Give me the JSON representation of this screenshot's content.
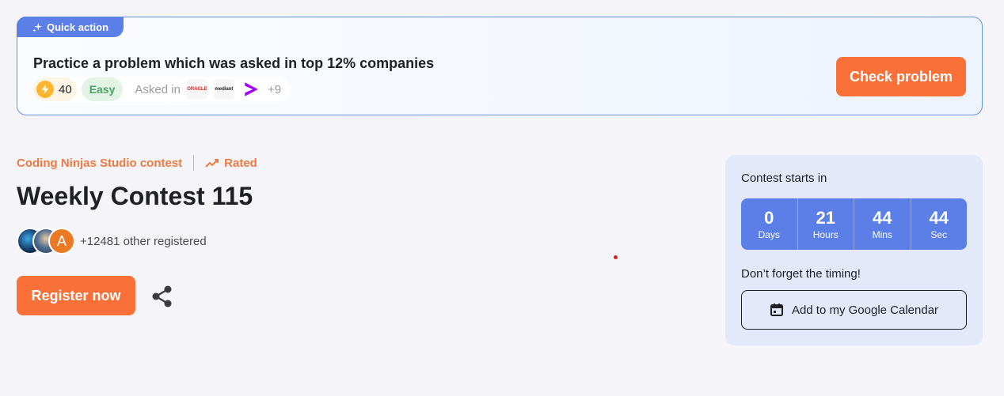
{
  "quick_action": {
    "tag": "Quick action",
    "title": "Practice a problem which was asked in top 12% companies",
    "points": "40",
    "difficulty": "Easy",
    "asked_in_label": "Asked in",
    "companies": [
      {
        "name": "ORACLE",
        "icon": "oracle-logo"
      },
      {
        "name": "mediant",
        "icon": "medianet-logo"
      },
      {
        "name": ">",
        "icon": "accenture-logo"
      }
    ],
    "more_companies": "+9",
    "cta": "Check problem"
  },
  "contest": {
    "category": "Coding Ninjas Studio contest",
    "rated_label": "Rated",
    "title": "Weekly Contest 115",
    "avatar_letter": "A",
    "registered_text": "+12481 other registered",
    "register_cta": "Register now"
  },
  "countdown": {
    "heading": "Contest starts in",
    "cells": [
      {
        "value": "0",
        "unit": "Days"
      },
      {
        "value": "21",
        "unit": "Hours"
      },
      {
        "value": "44",
        "unit": "Mins"
      },
      {
        "value": "44",
        "unit": "Sec"
      }
    ],
    "reminder": "Don’t forget the timing!",
    "calendar_cta": "Add to my Google Calendar"
  },
  "colors": {
    "accent_orange": "#f97039",
    "timer_blue": "#5b7fe6",
    "card_bg": "#e4e8fb",
    "easy_green": "#4aa566"
  }
}
